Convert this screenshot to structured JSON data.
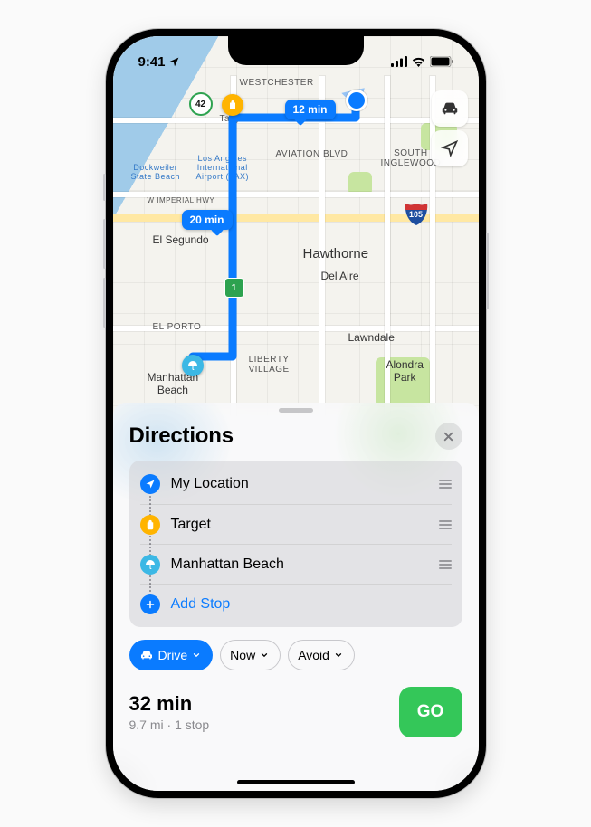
{
  "status": {
    "time": "9:41"
  },
  "map": {
    "areas": {
      "westchester": "WESTCHESTER",
      "aviation": "AVIATION BLVD",
      "south_inglewood": "SOUTH\nINGLEWOOD",
      "el_segundo": "El Segundo",
      "hawthorne": "Hawthorne",
      "del_aire": "Del Aire",
      "el_porto": "EL PORTO",
      "liberty_village": "LIBERTY\nVILLAGE",
      "lawndale": "Lawndale",
      "alondra_park": "Alondra\nPark",
      "manhattan_beach": "Manhattan\nBeach",
      "imperial": "W IMPERIAL HWY",
      "target_label": "Target",
      "dockweiler": "Dockweiler\nState Beach",
      "lax": "Los Angeles\nInternational\nAirport (LAX)"
    },
    "shields": {
      "ca1": "1",
      "ca42": "42",
      "i105": "105"
    },
    "eta_chips": {
      "segment1": "12 min",
      "segment2": "20 min"
    }
  },
  "sheet": {
    "title": "Directions",
    "stops": [
      {
        "key": "myloc",
        "label": "My Location",
        "icon": "location",
        "color": "#0a7bff",
        "draggable": true
      },
      {
        "key": "target",
        "label": "Target",
        "icon": "bag",
        "color": "#ffb400",
        "draggable": true
      },
      {
        "key": "beach",
        "label": "Manhattan Beach",
        "icon": "umbrella",
        "color": "#3cb8e5",
        "draggable": true
      },
      {
        "key": "add",
        "label": "Add Stop",
        "icon": "plus",
        "color": "#0a7bff",
        "draggable": false
      }
    ],
    "options": {
      "drive": "Drive",
      "now": "Now",
      "avoid": "Avoid"
    },
    "summary": {
      "eta": "32 min",
      "sub": "9.7 mi · 1 stop",
      "go": "GO"
    }
  }
}
